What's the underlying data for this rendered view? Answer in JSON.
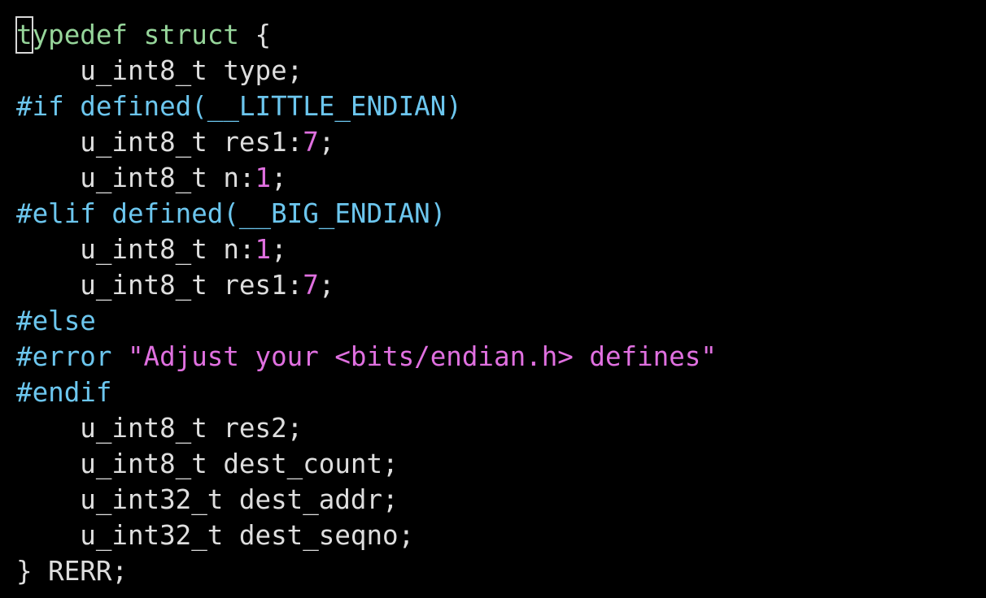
{
  "editor": {
    "colors": {
      "background": "#000000",
      "normal": "#dedede",
      "keyword": "#96d59a",
      "preproc": "#6cc6ee",
      "number": "#e070e0",
      "string": "#e070e0"
    },
    "lines": [
      {
        "tokens": [
          {
            "t": "t",
            "c": "keyword",
            "cursor": true
          },
          {
            "t": "ypedef",
            "c": "keyword"
          },
          {
            "t": " ",
            "c": "normal"
          },
          {
            "t": "struct",
            "c": "keyword"
          },
          {
            "t": " {",
            "c": "normal"
          }
        ]
      },
      {
        "tokens": [
          {
            "t": "    u_int8_t type;",
            "c": "normal"
          }
        ]
      },
      {
        "tokens": [
          {
            "t": "#if defined(__LITTLE_ENDIAN)",
            "c": "preproc"
          }
        ]
      },
      {
        "tokens": [
          {
            "t": "    u_int8_t res1:",
            "c": "normal"
          },
          {
            "t": "7",
            "c": "number"
          },
          {
            "t": ";",
            "c": "normal"
          }
        ]
      },
      {
        "tokens": [
          {
            "t": "    u_int8_t n:",
            "c": "normal"
          },
          {
            "t": "1",
            "c": "number"
          },
          {
            "t": ";",
            "c": "normal"
          }
        ]
      },
      {
        "tokens": [
          {
            "t": "#elif defined(__BIG_ENDIAN)",
            "c": "preproc"
          }
        ]
      },
      {
        "tokens": [
          {
            "t": "    u_int8_t n:",
            "c": "normal"
          },
          {
            "t": "1",
            "c": "number"
          },
          {
            "t": ";",
            "c": "normal"
          }
        ]
      },
      {
        "tokens": [
          {
            "t": "    u_int8_t res1:",
            "c": "normal"
          },
          {
            "t": "7",
            "c": "number"
          },
          {
            "t": ";",
            "c": "normal"
          }
        ]
      },
      {
        "tokens": [
          {
            "t": "#else",
            "c": "preproc"
          }
        ]
      },
      {
        "tokens": [
          {
            "t": "#error ",
            "c": "preproc"
          },
          {
            "t": "\"Adjust your <bits/endian.h> defines\"",
            "c": "string"
          }
        ]
      },
      {
        "tokens": [
          {
            "t": "#endif",
            "c": "preproc"
          }
        ]
      },
      {
        "tokens": [
          {
            "t": "    u_int8_t res2;",
            "c": "normal"
          }
        ]
      },
      {
        "tokens": [
          {
            "t": "    u_int8_t dest_count;",
            "c": "normal"
          }
        ]
      },
      {
        "tokens": [
          {
            "t": "    u_int32_t dest_addr;",
            "c": "normal"
          }
        ]
      },
      {
        "tokens": [
          {
            "t": "    u_int32_t dest_seqno;",
            "c": "normal"
          }
        ]
      },
      {
        "tokens": [
          {
            "t": "} RERR;",
            "c": "normal"
          }
        ]
      }
    ]
  }
}
